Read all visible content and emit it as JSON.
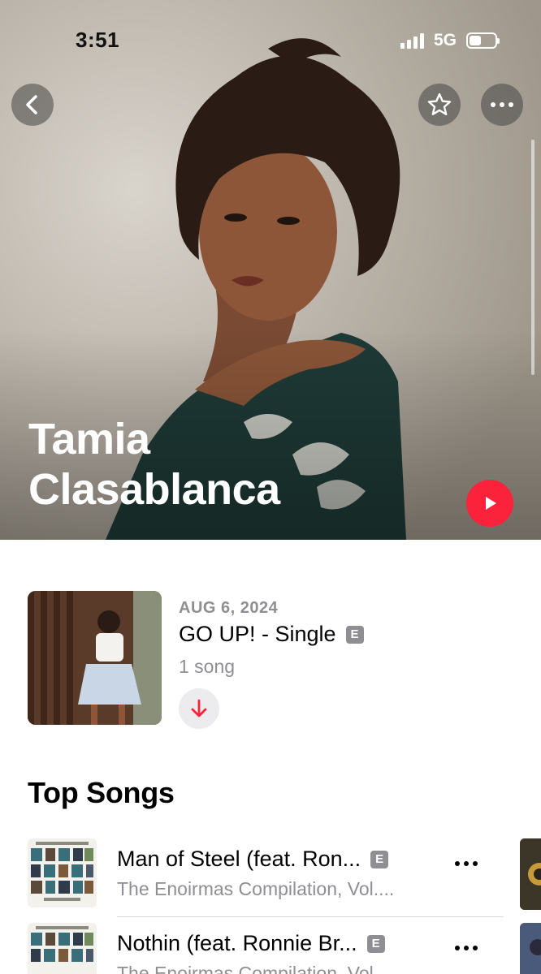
{
  "status_bar": {
    "time": "3:51",
    "network": "5G",
    "battery_level": 0.45
  },
  "header": {
    "back_icon": "chevron-left-icon",
    "favorite_icon": "star-icon",
    "more_icon": "ellipsis-icon"
  },
  "artist": {
    "name_line1": "Tamia",
    "name_line2": "Clasablanca",
    "play_icon": "play-icon"
  },
  "latest_release": {
    "date": "AUG 6, 2024",
    "title": "GO UP! - Single",
    "explicit": "E",
    "song_count": "1 song",
    "download_icon": "arrow-down-icon"
  },
  "top_songs": {
    "heading": "Top Songs",
    "items": [
      {
        "title": "Man of Steel (feat. Ron...",
        "explicit": "E",
        "subtitle": "The Enoirmas Compilation, Vol...."
      },
      {
        "title": "Nothin (feat. Ronnie Br...",
        "explicit": "E",
        "subtitle": "The Enoirmas Compilation, Vol..."
      }
    ]
  },
  "colors": {
    "accent": "#fa233b",
    "secondary_text": "#8e8e93",
    "divider": "#d8d8dc"
  }
}
